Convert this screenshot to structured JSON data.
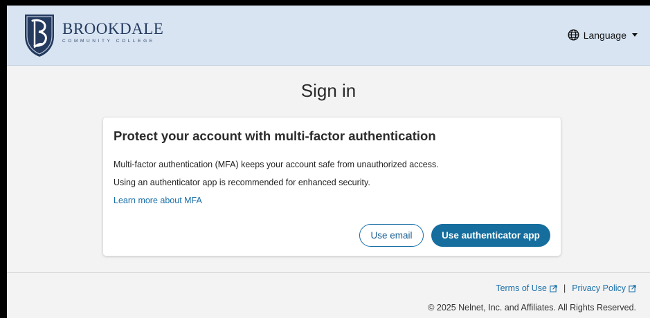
{
  "header": {
    "college_name": "BROOKDALE",
    "college_sub": "COMMUNITY COLLEGE",
    "language_label": "Language",
    "language_icon": "globe-icon"
  },
  "main": {
    "title": "Sign in",
    "card": {
      "heading": "Protect your account with multi-factor authentication",
      "paragraph1": "Multi-factor authentication (MFA) keeps your account safe from unauthorized access.",
      "paragraph2": "Using an authenticator app is recommended for enhanced security.",
      "learn_more": "Learn more about MFA",
      "email_button": "Use email",
      "app_button": "Use authenticator app"
    }
  },
  "footer": {
    "terms": "Terms of Use",
    "separator": "|",
    "privacy": "Privacy Policy",
    "copyright": "© 2025 Nelnet, Inc. and Affiliates. All Rights Reserved."
  },
  "colors": {
    "header_bg": "#d8e4f2",
    "accent": "#166e9e",
    "link": "#1a6fa8",
    "logo_navy": "#243a5e"
  }
}
